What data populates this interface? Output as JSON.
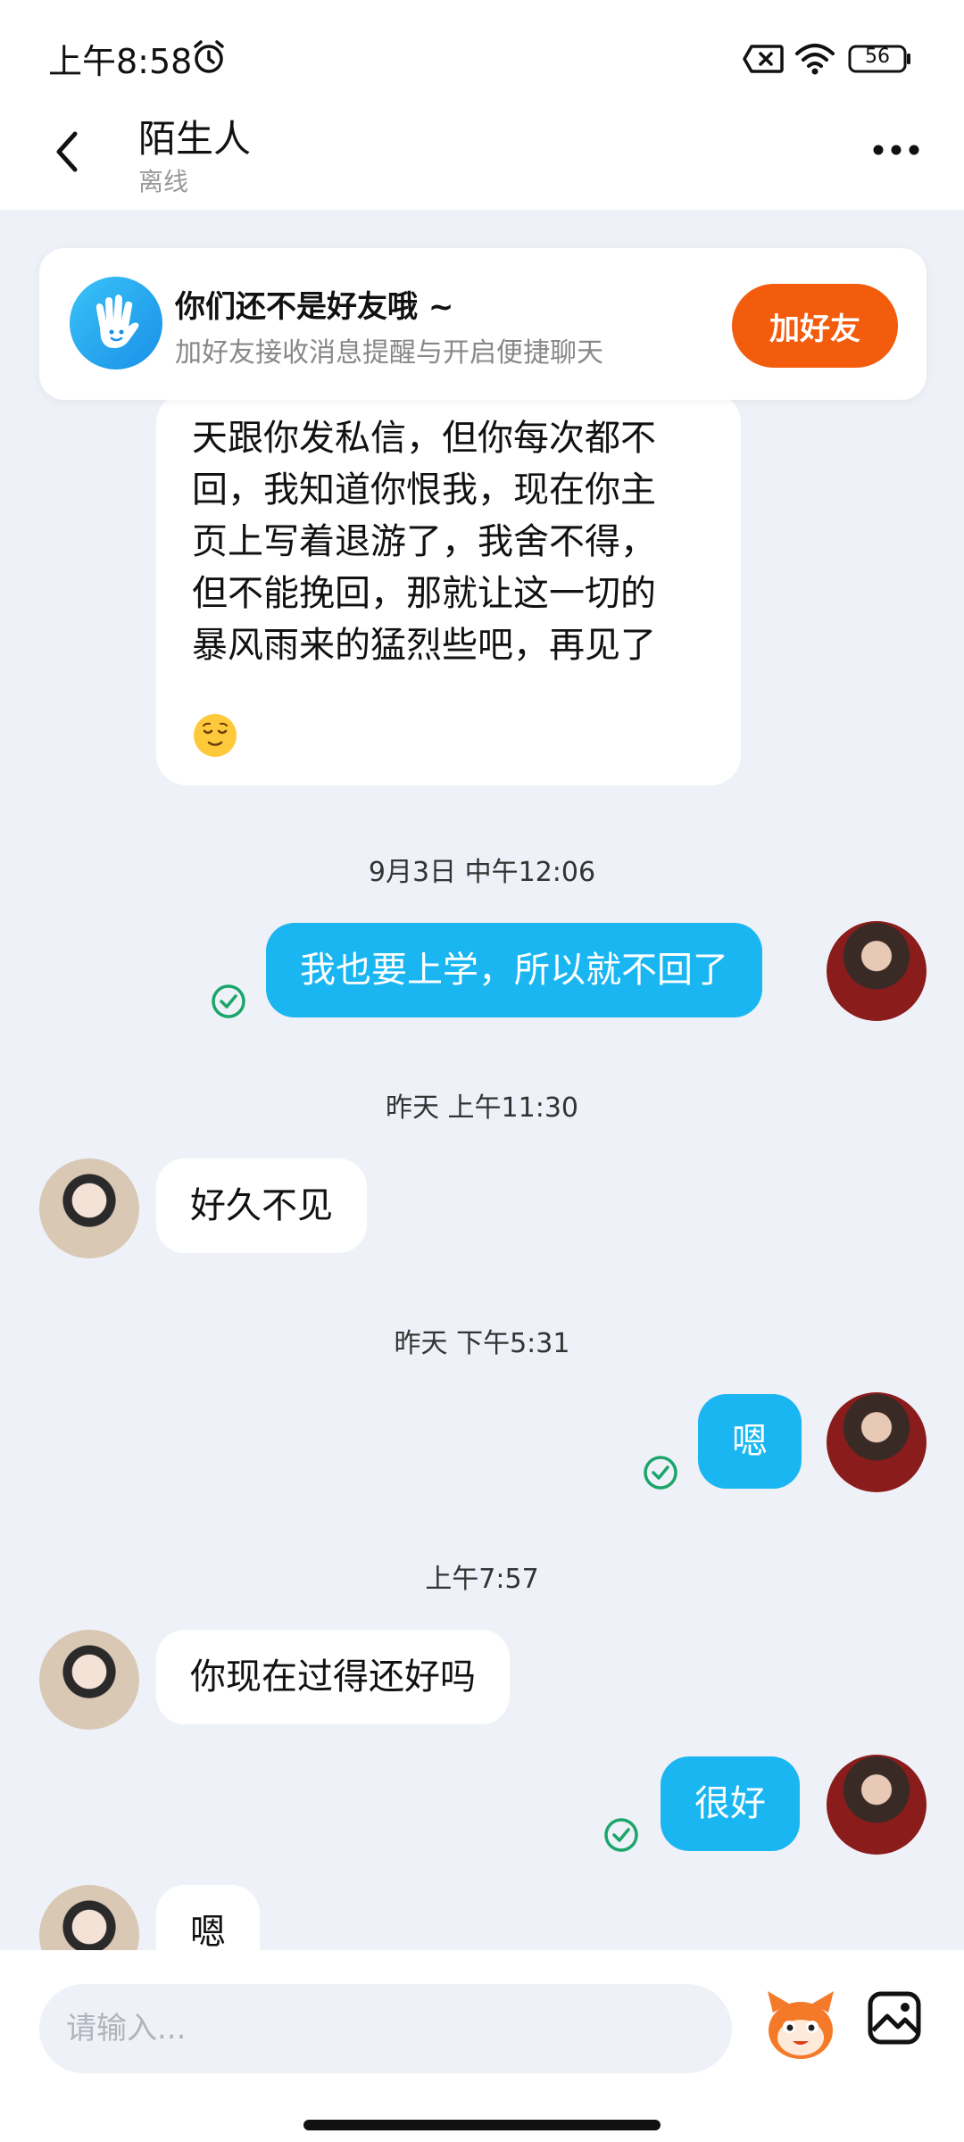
{
  "status_bar": {
    "time": "上午8:58",
    "battery_level": "56",
    "icons": [
      "alarm-icon",
      "sim-off-icon",
      "wifi-icon",
      "battery-icon"
    ]
  },
  "header": {
    "title": "陌生人",
    "subtitle": "离线",
    "back_icon": "chevron-left-icon",
    "more_icon": "more-dots-icon"
  },
  "friend_banner": {
    "title": "你们还不是好友哦 ~",
    "subtitle": "加好友接收消息提醒与开启便捷聊天",
    "button_label": "加好友",
    "icon": "hand-wave-icon"
  },
  "messages": [
    {
      "side": "left",
      "text": "天跟你发私信，但你每次都不\n回，我知道你恨我，现在你主\n页上写着退游了，我舍不得，\n但不能挽回，那就让这一切的\n暴风雨来的猛烈些吧，再见了",
      "emoji": "relieved-face-emoji"
    },
    {
      "timestamp": "9月3日 中午12:06"
    },
    {
      "side": "right",
      "text": "我也要上学，所以就不回了",
      "read": true
    },
    {
      "timestamp": "昨天 上午11:30"
    },
    {
      "side": "left",
      "text": "好久不见"
    },
    {
      "timestamp": "昨天 下午5:31"
    },
    {
      "side": "right",
      "text": "嗯",
      "read": true
    },
    {
      "timestamp": "上午7:57"
    },
    {
      "side": "left",
      "text": "你现在过得还好吗"
    },
    {
      "side": "right",
      "text": "很好",
      "read": true
    },
    {
      "side": "left",
      "text": "嗯"
    }
  ],
  "input_bar": {
    "placeholder": "请输入...",
    "value": "",
    "sticker_icon": "sticker-mascot-icon",
    "image_icon": "image-icon"
  },
  "colors": {
    "accent_blue": "#1ab6f2",
    "add_friend_orange": "#f25c0c",
    "read_green": "#1aa66a",
    "chat_background": "#eef1f7"
  }
}
